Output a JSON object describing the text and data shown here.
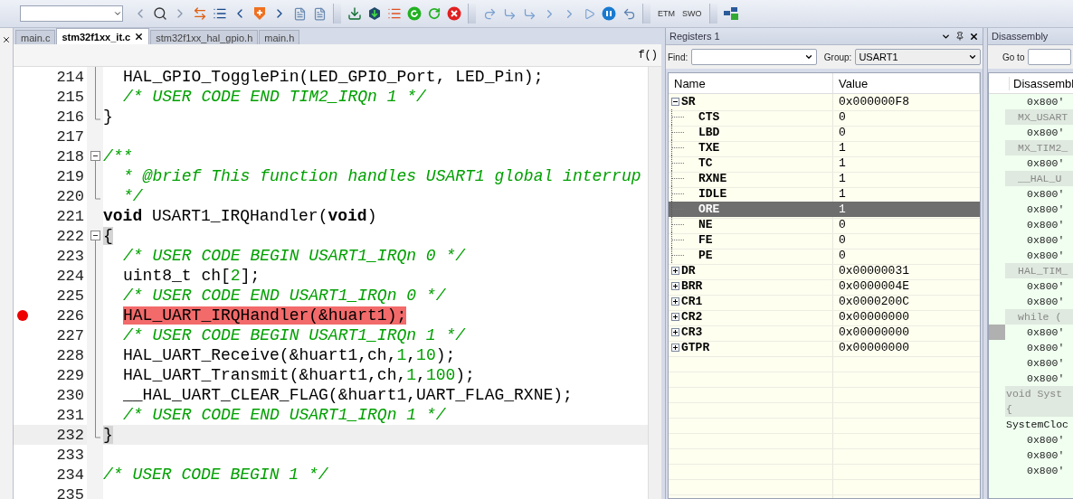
{
  "toolbar": {
    "text_buttons": [
      "ETM",
      "SWO"
    ]
  },
  "editor": {
    "tabs": [
      {
        "label": "main.c",
        "selected": false,
        "closable": false
      },
      {
        "label": "stm32f1xx_it.c",
        "selected": true,
        "closable": true
      },
      {
        "label": "stm32f1xx_hal_gpio.h",
        "selected": false,
        "closable": false
      },
      {
        "label": "main.h",
        "selected": false,
        "closable": false
      }
    ],
    "function_button": "f()",
    "lines": [
      {
        "number": "214",
        "indented": true,
        "fold_start": false,
        "fold_end": false,
        "breakpoint": false,
        "brace_match": false,
        "current": false,
        "tokens": [
          {
            "kind": "code",
            "text": "HAL_GPIO_TogglePin(LED_GPIO_Port, LED_Pin);"
          }
        ]
      },
      {
        "number": "215",
        "indented": true,
        "fold_start": false,
        "fold_end": false,
        "breakpoint": false,
        "brace_match": false,
        "current": false,
        "tokens": [
          {
            "kind": "comment",
            "text": "/* USER CODE END TIM2_IRQn 1 */"
          }
        ]
      },
      {
        "number": "216",
        "indented": false,
        "fold_start": false,
        "fold_end": true,
        "breakpoint": false,
        "brace_match": false,
        "current": false,
        "tokens": [
          {
            "kind": "code",
            "text": "}"
          }
        ]
      },
      {
        "number": "217",
        "fold_start": false,
        "fold_end": false,
        "breakpoint": false,
        "current": false
      },
      {
        "number": "218",
        "indented": false,
        "fold_start": true,
        "fold_end": false,
        "breakpoint": false,
        "brace_match": false,
        "current": false,
        "tokens": [
          {
            "kind": "comment",
            "text": "/**"
          }
        ]
      },
      {
        "number": "219",
        "indented": true,
        "fold_start": false,
        "fold_end": false,
        "breakpoint": false,
        "brace_match": false,
        "current": false,
        "tokens": [
          {
            "kind": "comment",
            "text": "* @brief This function handles USART1 global interrup"
          }
        ]
      },
      {
        "number": "220",
        "indented": true,
        "fold_start": false,
        "fold_end": true,
        "breakpoint": false,
        "brace_match": false,
        "current": false,
        "tokens": [
          {
            "kind": "comment",
            "text": "*/"
          }
        ]
      },
      {
        "number": "221",
        "indented": false,
        "fold_start": false,
        "fold_end": false,
        "breakpoint": false,
        "brace_match": false,
        "current": false,
        "tokens": [
          {
            "kind": "keyword",
            "text": "void"
          },
          {
            "kind": "code",
            "text": " USART1_IRQHandler("
          },
          {
            "kind": "keyword",
            "text": "void"
          },
          {
            "kind": "code",
            "text": ")"
          }
        ]
      },
      {
        "number": "222",
        "indented": false,
        "fold_start": true,
        "fold_end": false,
        "breakpoint": false,
        "brace_match": true,
        "current": false,
        "tokens": [
          {
            "kind": "code",
            "text": "{"
          }
        ]
      },
      {
        "number": "223",
        "indented": true,
        "fold_start": false,
        "fold_end": false,
        "breakpoint": false,
        "brace_match": false,
        "current": false,
        "tokens": [
          {
            "kind": "comment",
            "text": "/* USER CODE BEGIN USART1_IRQn 0 */"
          }
        ]
      },
      {
        "number": "224",
        "indented": true,
        "fold_start": false,
        "fold_end": false,
        "breakpoint": false,
        "brace_match": false,
        "current": false,
        "tokens": [
          {
            "kind": "code",
            "text": "uint8_t ch["
          },
          {
            "kind": "number",
            "text": "2"
          },
          {
            "kind": "code",
            "text": "];"
          }
        ]
      },
      {
        "number": "225",
        "indented": true,
        "fold_start": false,
        "fold_end": false,
        "breakpoint": false,
        "brace_match": false,
        "current": false,
        "tokens": [
          {
            "kind": "comment",
            "text": "/* USER CODE END USART1_IRQn 0 */"
          }
        ]
      },
      {
        "number": "226",
        "indented": true,
        "fold_start": false,
        "fold_end": false,
        "breakpoint": true,
        "brace_match": false,
        "current": false,
        "tokens": [
          {
            "kind": "code",
            "text": "HAL_UART_IRQHandler(&huart1);"
          }
        ]
      },
      {
        "number": "227",
        "indented": true,
        "fold_start": false,
        "fold_end": false,
        "breakpoint": false,
        "brace_match": false,
        "current": false,
        "tokens": [
          {
            "kind": "comment",
            "text": "/* USER CODE BEGIN USART1_IRQn 1 */"
          }
        ]
      },
      {
        "number": "228",
        "indented": true,
        "fold_start": false,
        "fold_end": false,
        "breakpoint": false,
        "brace_match": false,
        "current": false,
        "tokens": [
          {
            "kind": "code",
            "text": "HAL_UART_Receive(&huart1,ch,"
          },
          {
            "kind": "number",
            "text": "1"
          },
          {
            "kind": "code",
            "text": ","
          },
          {
            "kind": "number",
            "text": "10"
          },
          {
            "kind": "code",
            "text": ");"
          }
        ]
      },
      {
        "number": "229",
        "indented": true,
        "fold_start": false,
        "fold_end": false,
        "breakpoint": false,
        "brace_match": false,
        "current": false,
        "tokens": [
          {
            "kind": "code",
            "text": "HAL_UART_Transmit(&huart1,ch,"
          },
          {
            "kind": "number",
            "text": "1"
          },
          {
            "kind": "code",
            "text": ","
          },
          {
            "kind": "number",
            "text": "100"
          },
          {
            "kind": "code",
            "text": ");"
          }
        ]
      },
      {
        "number": "230",
        "indented": true,
        "fold_start": false,
        "fold_end": false,
        "breakpoint": false,
        "brace_match": false,
        "current": false,
        "tokens": [
          {
            "kind": "code",
            "text": "__HAL_UART_CLEAR_FLAG(&huart1,UART_FLAG_RXNE);"
          }
        ]
      },
      {
        "number": "231",
        "indented": true,
        "fold_start": false,
        "fold_end": false,
        "breakpoint": false,
        "brace_match": false,
        "current": false,
        "tokens": [
          {
            "kind": "comment",
            "text": "/* USER CODE END USART1_IRQn 1 */"
          }
        ]
      },
      {
        "number": "232",
        "indented": false,
        "fold_start": false,
        "fold_end": true,
        "breakpoint": false,
        "brace_match": true,
        "current": true,
        "tokens": [
          {
            "kind": "code",
            "text": "}"
          }
        ]
      },
      {
        "number": "233",
        "fold_start": false,
        "fold_end": false,
        "breakpoint": false,
        "current": false
      },
      {
        "number": "234",
        "indented": false,
        "fold_start": false,
        "fold_end": false,
        "breakpoint": false,
        "brace_match": false,
        "current": false,
        "tokens": [
          {
            "kind": "comment",
            "text": "/* USER CODE BEGIN 1 */"
          }
        ]
      },
      {
        "number": "235",
        "fold_start": false,
        "fold_end": false,
        "breakpoint": false,
        "current": false
      }
    ]
  },
  "registers": {
    "title": "Registers 1",
    "find_label": "Find:",
    "group_label": "Group:",
    "group_value": "USART1",
    "columns": [
      "Name",
      "Value"
    ],
    "rows": [
      {
        "name": "SR",
        "value": "0x000000F8",
        "expanded": true,
        "selected": false,
        "children": [
          {
            "name": "CTS",
            "value": "0",
            "selected": false
          },
          {
            "name": "LBD",
            "value": "0",
            "selected": false
          },
          {
            "name": "TXE",
            "value": "1",
            "selected": false
          },
          {
            "name": "TC",
            "value": "1",
            "selected": false
          },
          {
            "name": "RXNE",
            "value": "1",
            "selected": false
          },
          {
            "name": "IDLE",
            "value": "1",
            "selected": false
          },
          {
            "name": "ORE",
            "value": "1",
            "selected": true
          },
          {
            "name": "NE",
            "value": "0",
            "selected": false
          },
          {
            "name": "FE",
            "value": "0",
            "selected": false
          },
          {
            "name": "PE",
            "value": "0",
            "selected": false
          }
        ]
      },
      {
        "name": "DR",
        "value": "0x00000031",
        "expanded": false,
        "selected": false
      },
      {
        "name": "BRR",
        "value": "0x0000004E",
        "expanded": false,
        "selected": false
      },
      {
        "name": "CR1",
        "value": "0x0000200C",
        "expanded": false,
        "selected": false
      },
      {
        "name": "CR2",
        "value": "0x00000000",
        "expanded": false,
        "selected": false
      },
      {
        "name": "CR3",
        "value": "0x00000000",
        "expanded": false,
        "selected": false
      },
      {
        "name": "GTPR",
        "value": "0x00000000",
        "expanded": false,
        "selected": false
      }
    ]
  },
  "disassembly": {
    "title": "Disassembly",
    "goto_label": "Go to",
    "column": "Disassembl",
    "lines": [
      {
        "kind": "address",
        "text": "0x800'",
        "current": false
      },
      {
        "kind": "source",
        "text": "MX_USART",
        "current": false
      },
      {
        "kind": "address",
        "text": "0x800'",
        "current": false
      },
      {
        "kind": "source",
        "text": "MX_TIM2_",
        "current": false
      },
      {
        "kind": "address",
        "text": "0x800'",
        "current": false
      },
      {
        "kind": "source",
        "text": "__HAL_U",
        "current": false
      },
      {
        "kind": "address",
        "text": "0x800'",
        "current": false
      },
      {
        "kind": "address",
        "text": "0x800'",
        "current": false
      },
      {
        "kind": "address",
        "text": "0x800'",
        "current": false
      },
      {
        "kind": "address",
        "text": "0x800'",
        "current": false
      },
      {
        "kind": "address",
        "text": "0x800'",
        "current": false
      },
      {
        "kind": "source",
        "text": "HAL_TIM_",
        "current": false
      },
      {
        "kind": "address",
        "text": "0x800'",
        "current": false
      },
      {
        "kind": "address",
        "text": "0x800'",
        "current": false
      },
      {
        "kind": "source",
        "text": "while (",
        "current": false
      },
      {
        "kind": "address",
        "text": "0x800'",
        "current": true
      },
      {
        "kind": "address",
        "text": "0x800'",
        "current": false
      },
      {
        "kind": "address",
        "text": "0x800'",
        "current": false
      },
      {
        "kind": "address",
        "text": "0x800'",
        "current": false
      },
      {
        "kind": "function",
        "text": "void Syst",
        "current": false
      },
      {
        "kind": "function",
        "text": "{",
        "current": false
      },
      {
        "kind": "plain",
        "text": "SystemCloc",
        "current": false
      },
      {
        "kind": "address",
        "text": "0x800'",
        "current": false
      },
      {
        "kind": "address",
        "text": "0x800'",
        "current": false
      },
      {
        "kind": "address",
        "text": "0x800'",
        "current": false
      }
    ]
  }
}
